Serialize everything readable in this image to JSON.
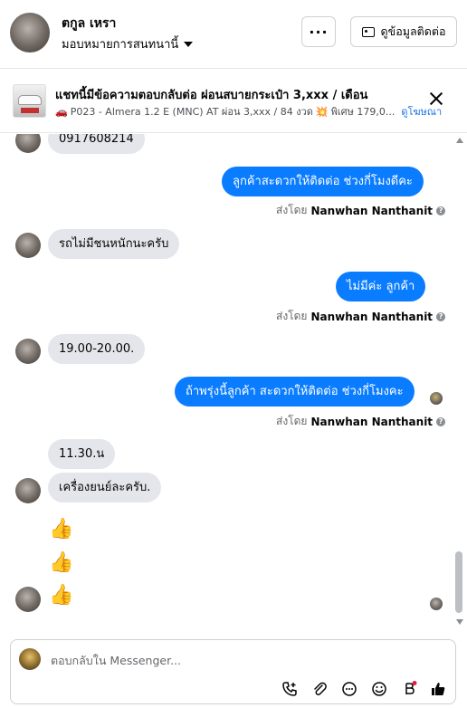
{
  "header": {
    "contact_name": "ตกูล เหรา",
    "assignee_label": "มอบหมายการสนทนานี้",
    "more_label": "···",
    "view_contact_label": "ดูข้อมูลติดต่อ"
  },
  "ad": {
    "title": "แชทนี้มีข้อความตอบกลับต่อ ผ่อนสบายกระเป๋า 3,xxx / เดือน",
    "car_emoji": "🚗",
    "subtitle": "P023 - Almera 1.2 E (MNC) AT ผ่อน 3,xxx / 84 งวด",
    "burst_emoji": "💥",
    "subtitle_tail": "พิเศษ 179,0...",
    "link": "ดูโฆษณา"
  },
  "messages": [
    {
      "from": "contact",
      "text": "0917608214"
    },
    {
      "from": "page",
      "text": "ลูกค้าสะดวกให้ติดต่อ ช่วงกี่โมงดีคะ",
      "sent_by_prefix": "ส่งโดย",
      "sent_by_name": "Nanwhan Nanthanit"
    },
    {
      "from": "contact",
      "text": "รถไม่มีชนหนักนะครับ"
    },
    {
      "from": "page",
      "text": "ไม่มีค่ะ  ลูกค้า",
      "sent_by_prefix": "ส่งโดย",
      "sent_by_name": "Nanwhan Nanthanit"
    },
    {
      "from": "contact",
      "text": "19.00-20.00."
    },
    {
      "from": "page",
      "text": "ถ้าพรุ่งนี้ลูกค้า สะดวกให้ติดต่อ ช่วงกี่โมงคะ",
      "sent_by_prefix": "ส่งโดย",
      "sent_by_name": "Nanwhan Nanthanit"
    },
    {
      "from": "contact",
      "text": "11.30.น"
    },
    {
      "from": "contact",
      "text": "เครื่องยนย์ละครับ."
    },
    {
      "from": "contact",
      "text": "👍"
    },
    {
      "from": "contact",
      "text": "👍"
    },
    {
      "from": "contact",
      "text": "👍"
    }
  ],
  "composer": {
    "placeholder": "ตอบกลับใน Messenger..."
  },
  "colors": {
    "outgoing_bubble": "#0a7cff",
    "incoming_bubble": "#e4e6eb",
    "link": "#1b74e4"
  }
}
